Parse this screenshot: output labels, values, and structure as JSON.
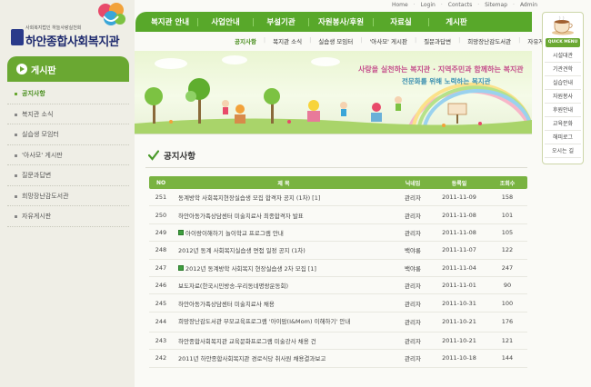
{
  "logo": {
    "subtitle": "사회복지법인 하늘사랑실천회",
    "name": "하안종합사회복지관"
  },
  "util": {
    "links": [
      "Home",
      "Login",
      "Contacts",
      "Sitemap",
      "Admin"
    ]
  },
  "gnb": {
    "items": [
      "복지관 안내",
      "사업안내",
      "부설기관",
      "자원봉사/후원",
      "자료실",
      "게시판"
    ]
  },
  "lnb": {
    "items": [
      "공지사항",
      "복지관 소식",
      "실습생 모임터",
      "'아사모' 게시판",
      "질문과답변",
      "희망장난감도서관",
      "자유게시판"
    ]
  },
  "quick": {
    "heading": "QUICK MENU",
    "items": [
      "시설대관",
      "기관견학",
      "실습안내",
      "자원봉사",
      "후원안내",
      "교육문화",
      "해피로그",
      "오시는 길"
    ]
  },
  "banner": {
    "line1": "사랑을 실천하는 복지관 · 지역주민과 함께하는 복지관",
    "line2": "전문화를 위해 노력하는 복지관"
  },
  "left_menu": {
    "title": "게시판",
    "items": [
      "공지사항",
      "복지관 소식",
      "실습생 모임터",
      "'아사모' 게시판",
      "질문과답변",
      "희망장난감도서관",
      "자유게시판"
    ]
  },
  "page_title": "공지사항",
  "board": {
    "headers": {
      "no": "NO",
      "title": "제 목",
      "writer": "닉네임",
      "date": "등록일",
      "views": "조회수"
    },
    "rows": [
      {
        "no": "251",
        "title": "동계방학 사회복지현장실습생 모집 합격자 공지 (1차) [1]",
        "file": false,
        "writer": "관리자",
        "date": "2011-11-09",
        "views": "158"
      },
      {
        "no": "250",
        "title": "하안아동가족상담센터 미술치료사 최종합격자 발표",
        "file": false,
        "writer": "관리자",
        "date": "2011-11-08",
        "views": "101"
      },
      {
        "no": "249",
        "title": "아이랑이해하기 놀이학교 프로그램 안내",
        "file": true,
        "writer": "관리자",
        "date": "2011-11-08",
        "views": "105"
      },
      {
        "no": "248",
        "title": "2012년 동계 사회복지실습생 면접 일정 공지 (1차)",
        "file": false,
        "writer": "백야롱",
        "date": "2011-11-07",
        "views": "122"
      },
      {
        "no": "247",
        "title": "2012년 동계방학 사회복지 현장실습생 2차 모집 [1]",
        "file": true,
        "writer": "백야롱",
        "date": "2011-11-04",
        "views": "247"
      },
      {
        "no": "246",
        "title": "보도자료(한국시민방송-우리동네명랑운동회)",
        "file": false,
        "writer": "관리자",
        "date": "2011-11-01",
        "views": "90"
      },
      {
        "no": "245",
        "title": "하안아동가족상담센터 미술치료사 채용",
        "file": false,
        "writer": "관리자",
        "date": "2011-10-31",
        "views": "100"
      },
      {
        "no": "244",
        "title": "희망장난감도서관 부모교육프로그램 '아이맘(I&Mom) 이해하기' 안내",
        "file": false,
        "writer": "관리자",
        "date": "2011-10-21",
        "views": "176",
        "tall": true
      },
      {
        "no": "243",
        "title": "하안종합사회복지관 교육문화프로그램 미술강사 채용 건",
        "file": false,
        "writer": "관리자",
        "date": "2011-10-21",
        "views": "121"
      },
      {
        "no": "242",
        "title": "2011년 하안종합사회복지관 경로식당 취사원 채용결과보고",
        "file": false,
        "writer": "관리자",
        "date": "2011-10-18",
        "views": "144"
      }
    ]
  },
  "colors": {
    "brand_green": "#6aa832",
    "nav_green": "#58a82a",
    "logo_navy": "#1e2a6e"
  }
}
